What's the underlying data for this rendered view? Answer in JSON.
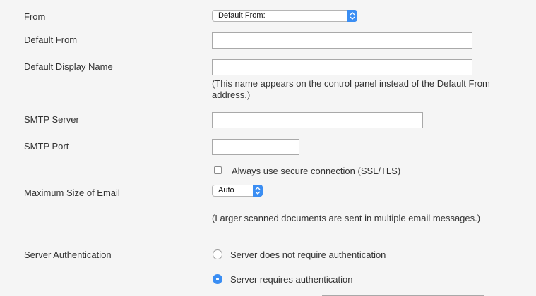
{
  "from": {
    "label": "From",
    "select_value": "Default From:"
  },
  "default_from": {
    "label": "Default From",
    "value": ""
  },
  "default_display_name": {
    "label": "Default Display Name",
    "value": "",
    "note": "(This name appears on the control panel instead of the Default From address.)"
  },
  "smtp_server": {
    "label": "SMTP Server",
    "value": ""
  },
  "smtp_port": {
    "label": "SMTP Port",
    "value": ""
  },
  "secure_connection": {
    "label": "Always use secure connection (SSL/TLS)",
    "checked": false
  },
  "max_email_size": {
    "label": "Maximum Size of Email",
    "select_value": "Auto",
    "note": "(Larger scanned documents are sent in multiple email messages.)"
  },
  "server_auth": {
    "label": "Server Authentication",
    "options": [
      {
        "label": "Server does not require authentication",
        "selected": false
      },
      {
        "label": "Server requires authentication",
        "selected": true
      }
    ]
  },
  "colors": {
    "accent": "#3b8ef3",
    "background": "#f5f5f5"
  }
}
